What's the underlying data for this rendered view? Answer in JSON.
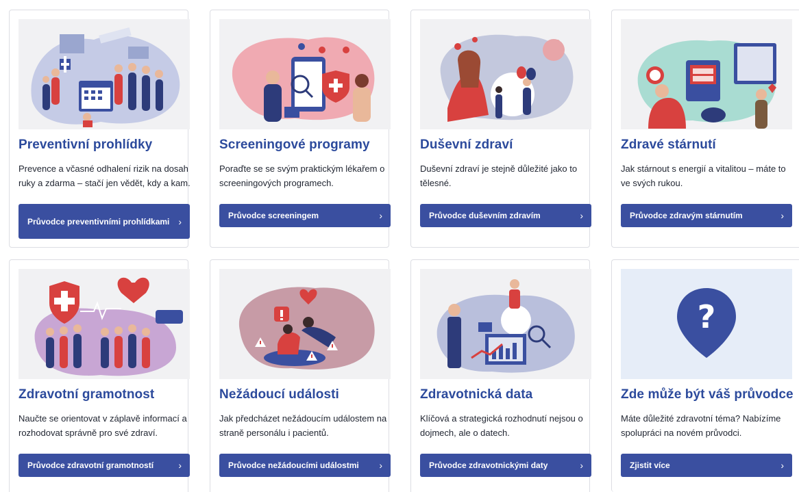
{
  "cards": [
    {
      "title": "Preventivní prohlídky",
      "desc": "Prevence a včasné odhalení rizik na dosah ruky a zdarma – stačí jen vědět, kdy a kam.",
      "button": "Průvodce preventivními prohlídkami"
    },
    {
      "title": "Screeningové programy",
      "desc": "Poraďte se se svým praktickým lékařem o screeningových programech.",
      "button": "Průvodce screeningem"
    },
    {
      "title": "Duševní zdraví",
      "desc": "Duševní zdraví je stejně důležité jako to tělesné.",
      "button": "Průvodce duševním zdravím"
    },
    {
      "title": "Zdravé stárnutí",
      "desc": "Jak stárnout s energií a vitalitou – máte to ve svých rukou.",
      "button": "Průvodce zdravým stárnutím"
    },
    {
      "title": "Zdravotní gramotnost",
      "desc": "Naučte se orientovat v záplavě informací a rozhodovat správně pro své zdraví.",
      "button": "Průvodce zdravotní gramotností"
    },
    {
      "title": "Nežádoucí události",
      "desc": "Jak předcházet nežádoucím událostem na straně personálu i pacientů.",
      "button": "Průvodce nežádoucími událostmi"
    },
    {
      "title": "Zdravotnická data",
      "desc": "Klíčová a strategická rozhodnutí nejsou o dojmech, ale o datech.",
      "button": "Průvodce zdravotnickými daty"
    },
    {
      "title": "Zde může být váš průvodce",
      "desc": "Máte důležité zdravotní téma? Nabízíme spolupráci na novém průvodci.",
      "button": "Zjistit více"
    }
  ],
  "chevron": "›",
  "colors": {
    "primary": "#3a4fa0",
    "title": "#2c4a9c",
    "heart": "#e2343b"
  }
}
